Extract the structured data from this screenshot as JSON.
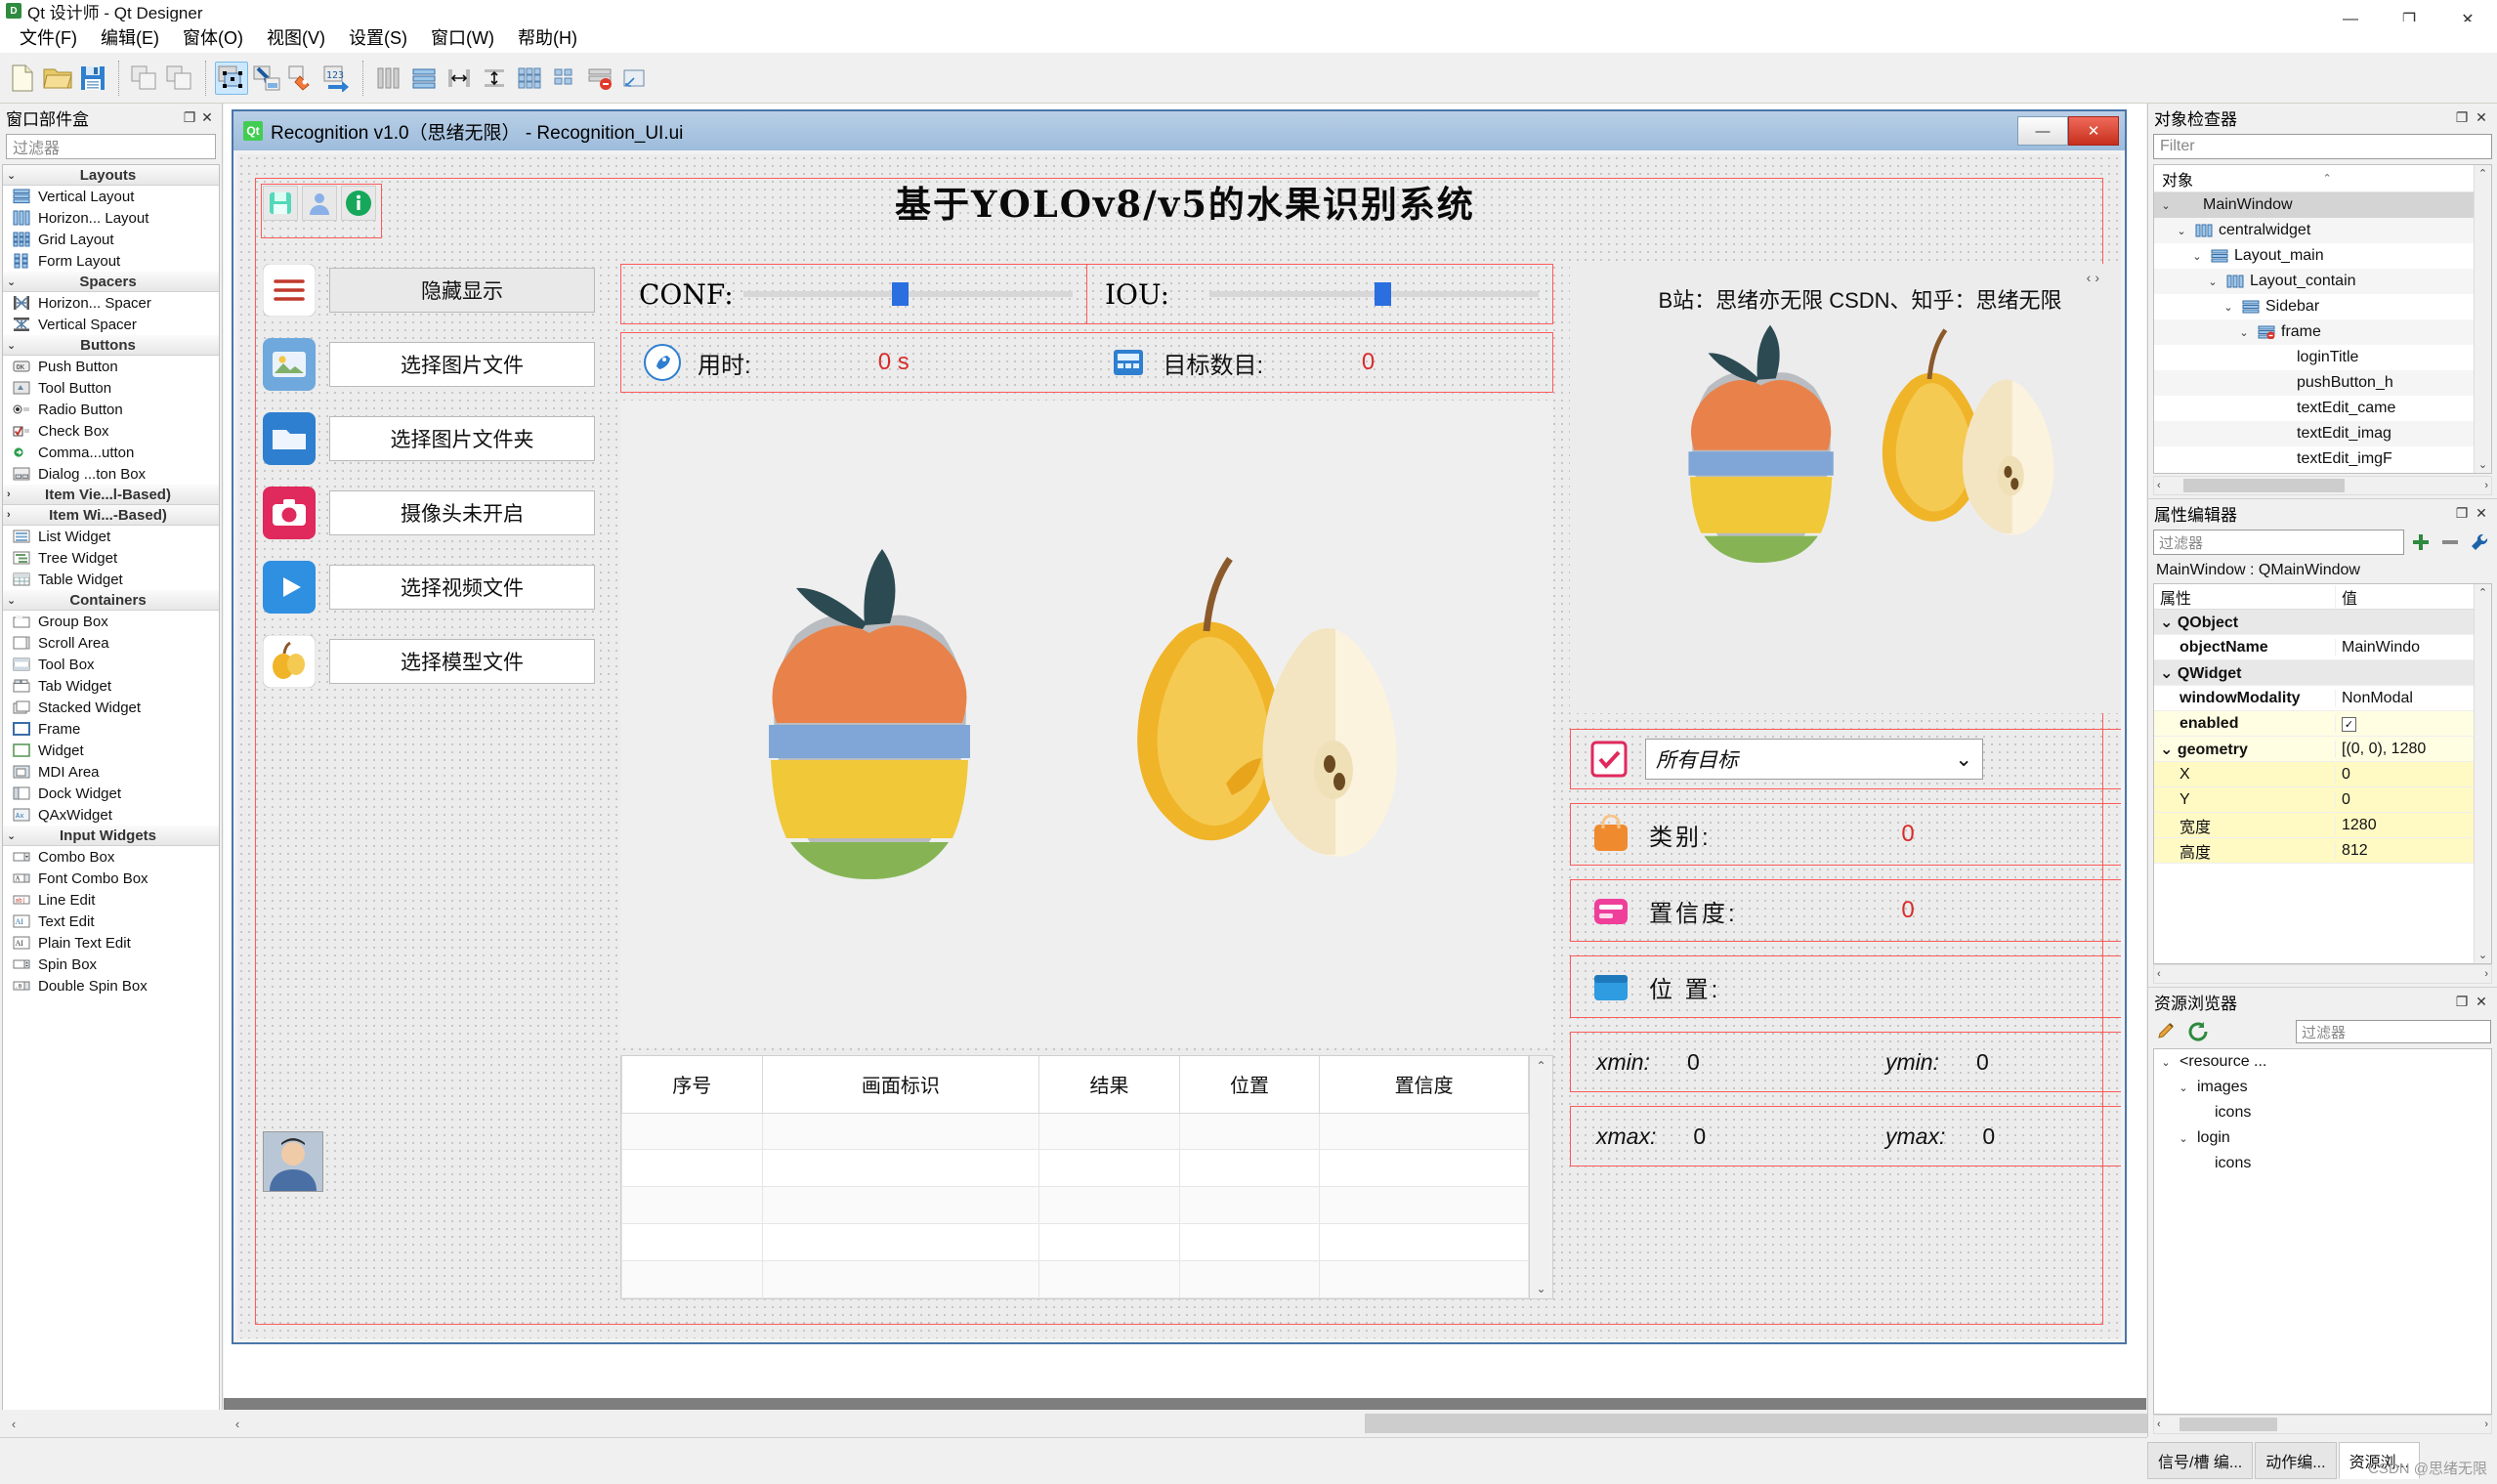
{
  "app": {
    "window_title": "Qt 设计师 - Qt Designer",
    "logo_text": "D",
    "minimize": "—",
    "maximize": "❐",
    "close": "✕"
  },
  "menubar": {
    "items": [
      {
        "label": "文件(F)"
      },
      {
        "label": "编辑(E)"
      },
      {
        "label": "窗体(O)"
      },
      {
        "label": "视图(V)"
      },
      {
        "label": "设置(S)"
      },
      {
        "label": "窗口(W)"
      },
      {
        "label": "帮助(H)"
      }
    ]
  },
  "toolbar": {
    "buttons": [
      {
        "name": "new-form",
        "title": "新建"
      },
      {
        "name": "open-form",
        "title": "打开"
      },
      {
        "name": "save-form",
        "title": "保存"
      },
      {
        "name": "copy",
        "title": "复制"
      },
      {
        "name": "paste",
        "title": "粘贴"
      },
      {
        "name": "edit-widgets",
        "title": "编辑控件",
        "active": true
      },
      {
        "name": "edit-signals-slots",
        "title": "编辑信号/槽"
      },
      {
        "name": "edit-buddies",
        "title": "编辑伙伴"
      },
      {
        "name": "edit-tab-order",
        "title": "编辑 Tab 顺序"
      },
      {
        "name": "layout-horizontal",
        "title": "水平布局"
      },
      {
        "name": "layout-vertical",
        "title": "垂直布局"
      },
      {
        "name": "layout-splitter-h",
        "title": "水平分裂器布局"
      },
      {
        "name": "layout-splitter-v",
        "title": "垂直分裂器布局"
      },
      {
        "name": "layout-grid",
        "title": "栅格布局"
      },
      {
        "name": "layout-form",
        "title": "表单布局"
      },
      {
        "name": "break-layout",
        "title": "打破布局"
      },
      {
        "name": "adjust-size",
        "title": "调整大小"
      }
    ]
  },
  "widget_box": {
    "title": "窗口部件盒",
    "filter_placeholder": "过滤器",
    "groups": [
      {
        "name": "Layouts",
        "items": [
          {
            "label": "Vertical Layout",
            "icon": "vertical-layout-icon"
          },
          {
            "label": "Horizon... Layout",
            "icon": "horizontal-layout-icon"
          },
          {
            "label": "Grid Layout",
            "icon": "grid-layout-icon"
          },
          {
            "label": "Form Layout",
            "icon": "form-layout-icon"
          }
        ]
      },
      {
        "name": "Spacers",
        "items": [
          {
            "label": "Horizon... Spacer",
            "icon": "horizontal-spacer-icon"
          },
          {
            "label": "Vertical Spacer",
            "icon": "vertical-spacer-icon"
          }
        ]
      },
      {
        "name": "Buttons",
        "items": [
          {
            "label": "Push Button",
            "icon": "push-button-icon"
          },
          {
            "label": "Tool Button",
            "icon": "tool-button-icon"
          },
          {
            "label": "Radio Button",
            "icon": "radio-button-icon"
          },
          {
            "label": "Check Box",
            "icon": "check-box-icon"
          },
          {
            "label": "Comma...utton",
            "icon": "command-button-icon"
          },
          {
            "label": "Dialog ...ton Box",
            "icon": "dialog-button-box-icon"
          }
        ]
      },
      {
        "name": "Item Vie...l-Based)",
        "items": []
      },
      {
        "name": "Item Wi...-Based)",
        "items": [
          {
            "label": "List Widget",
            "icon": "list-widget-icon"
          },
          {
            "label": "Tree Widget",
            "icon": "tree-widget-icon"
          },
          {
            "label": "Table Widget",
            "icon": "table-widget-icon"
          }
        ]
      },
      {
        "name": "Containers",
        "items": [
          {
            "label": "Group Box",
            "icon": "group-box-icon"
          },
          {
            "label": "Scroll Area",
            "icon": "scroll-area-icon"
          },
          {
            "label": "Tool Box",
            "icon": "tool-box-icon"
          },
          {
            "label": "Tab Widget",
            "icon": "tab-widget-icon"
          },
          {
            "label": "Stacked Widget",
            "icon": "stacked-widget-icon"
          },
          {
            "label": "Frame",
            "icon": "frame-icon"
          },
          {
            "label": "Widget",
            "icon": "widget-icon"
          },
          {
            "label": "MDI Area",
            "icon": "mdi-area-icon"
          },
          {
            "label": "Dock Widget",
            "icon": "dock-widget-icon"
          },
          {
            "label": "QAxWidget",
            "icon": "qaxwidget-icon"
          }
        ]
      },
      {
        "name": "Input Widgets",
        "items": [
          {
            "label": "Combo Box",
            "icon": "combo-box-icon"
          },
          {
            "label": "Font Combo Box",
            "icon": "font-combo-box-icon"
          },
          {
            "label": "Line Edit",
            "icon": "line-edit-icon"
          },
          {
            "label": "Text Edit",
            "icon": "text-edit-icon"
          },
          {
            "label": "Plain Text Edit",
            "icon": "plain-text-edit-icon"
          },
          {
            "label": "Spin Box",
            "icon": "spin-box-icon"
          },
          {
            "label": "Double Spin Box",
            "icon": "double-spin-box-icon"
          }
        ]
      }
    ]
  },
  "form_window": {
    "title": "Recognition v1.0（思绪无限） - Recognition_UI.ui",
    "qt_badge": "Qt",
    "minimize": "—",
    "close": "✕"
  },
  "form": {
    "app_title": "基于YOLOv8/v5的水果识别系统",
    "top_icons": [
      {
        "name": "save-icon"
      },
      {
        "name": "user-icon"
      },
      {
        "name": "info-icon"
      }
    ],
    "sidebar": [
      {
        "icon": "menu-lines-icon",
        "label": "隐藏显示",
        "kind": "button"
      },
      {
        "icon": "image-icon",
        "label": "选择图片文件",
        "kind": "field"
      },
      {
        "icon": "folder-icon",
        "label": "选择图片文件夹",
        "kind": "field"
      },
      {
        "icon": "camera-icon",
        "label": "摄像头未开启",
        "kind": "field"
      },
      {
        "icon": "video-icon",
        "label": "选择视频文件",
        "kind": "field"
      },
      {
        "icon": "model-icon",
        "label": "选择模型文件",
        "kind": "field"
      }
    ],
    "conf": {
      "label": "CONF:",
      "value": 0.45
    },
    "iou": {
      "label": "IOU:",
      "value": 0.5
    },
    "time": {
      "icon": "rocket-icon",
      "label": "用时:",
      "value": "0 s"
    },
    "count": {
      "icon": "counter-icon",
      "label": "目标数目:",
      "value": "0"
    },
    "table": {
      "columns": [
        "序号",
        "画面标识",
        "结果",
        "位置",
        "置信度"
      ],
      "rows": []
    },
    "right_panel": {
      "banner_text": "B站：思绪亦无限 CSDN、知乎：思绪无限",
      "target_select": {
        "icon": "target-check-icon",
        "value": "所有目标",
        "caret": "⌄"
      },
      "results": [
        {
          "icon": "category-icon",
          "label": "类别:",
          "value": "0"
        },
        {
          "icon": "confidence-icon",
          "label": "置信度:",
          "value": "0"
        },
        {
          "icon": "location-icon",
          "label": "位 置:",
          "value": ""
        }
      ],
      "coords": [
        {
          "label": "xmin:",
          "value": "0",
          "label2": "ymin:",
          "value2": "0"
        },
        {
          "label": "xmax:",
          "value": "0",
          "label2": "ymax:",
          "value2": "0"
        }
      ]
    }
  },
  "object_inspector": {
    "title": "对象检查器",
    "filter_placeholder": "Filter",
    "column_header": "对象",
    "nodes": [
      {
        "label": "MainWindow",
        "depth": 0,
        "twisty": "⌄",
        "icon": "",
        "selected": true
      },
      {
        "label": "centralwidget",
        "depth": 1,
        "twisty": "⌄",
        "icon": "horizontal-layout-icon"
      },
      {
        "label": "Layout_main",
        "depth": 2,
        "twisty": "⌄",
        "icon": "vertical-layout-icon"
      },
      {
        "label": "Layout_contain",
        "depth": 3,
        "twisty": "⌄",
        "icon": "horizontal-layout-icon"
      },
      {
        "label": "Sidebar",
        "depth": 4,
        "twisty": "⌄",
        "icon": "vertical-layout-icon"
      },
      {
        "label": "frame",
        "depth": 5,
        "twisty": "⌄",
        "icon": "broken-layout-icon"
      },
      {
        "label": "loginTitle",
        "depth": 6,
        "twisty": "",
        "icon": ""
      },
      {
        "label": "pushButton_h",
        "depth": 6,
        "twisty": "",
        "icon": ""
      },
      {
        "label": "textEdit_came",
        "depth": 6,
        "twisty": "",
        "icon": ""
      },
      {
        "label": "textEdit_imag",
        "depth": 6,
        "twisty": "",
        "icon": ""
      },
      {
        "label": "textEdit_imgF",
        "depth": 6,
        "twisty": "",
        "icon": ""
      }
    ]
  },
  "property_editor": {
    "title": "属性编辑器",
    "filter_placeholder": "过滤器",
    "add_icon": "plus-icon",
    "remove_icon": "minus-icon",
    "config_icon": "wrench-icon",
    "object_line": "MainWindow : QMainWindow",
    "col_key": "属性",
    "col_value": "值",
    "rows": [
      {
        "key": "QObject",
        "value": "",
        "group": true
      },
      {
        "key": "objectName",
        "value": "MainWindo",
        "bold": true,
        "indent": true
      },
      {
        "key": "QWidget",
        "value": "",
        "group": true
      },
      {
        "key": "windowModality",
        "value": "NonModal",
        "bold": true,
        "indent": true
      },
      {
        "key": "enabled",
        "value": "",
        "bold": true,
        "indent": true,
        "checkbox": true,
        "checked": true,
        "highlight": true
      },
      {
        "key": "geometry",
        "value": "[(0, 0), 1280",
        "bold": true,
        "twisty": "⌄",
        "highlight": true
      },
      {
        "key": "X",
        "value": "0",
        "indent": true,
        "highlight2": true
      },
      {
        "key": "Y",
        "value": "0",
        "indent": true,
        "highlight2": true
      },
      {
        "key": "宽度",
        "value": "1280",
        "indent": true,
        "highlight2": true
      },
      {
        "key": "高度",
        "value": "812",
        "indent": true,
        "highlight2": true
      }
    ]
  },
  "resource_browser": {
    "title": "资源浏览器",
    "edit_icon": "pencil-icon",
    "reload_icon": "reload-icon",
    "filter_placeholder": "过滤器",
    "nodes": [
      {
        "label": "<resource ...",
        "depth": 0,
        "twisty": "⌄"
      },
      {
        "label": "images",
        "depth": 1,
        "twisty": "⌄"
      },
      {
        "label": "icons",
        "depth": 2,
        "twisty": ""
      },
      {
        "label": "login",
        "depth": 1,
        "twisty": "⌄"
      },
      {
        "label": "icons",
        "depth": 2,
        "twisty": ""
      }
    ]
  },
  "bottom_tabs": [
    {
      "label": "信号/槽 编...",
      "selected": false
    },
    {
      "label": "动作编...",
      "selected": false
    },
    {
      "label": "资源浏...",
      "selected": true
    }
  ],
  "watermark": "CSDN @思绪无限",
  "scroll": {
    "left_arrow": "‹",
    "right_arrow": "›",
    "up_arrow": "⌃",
    "down_arrow": "⌄"
  },
  "colors": {
    "accent": "#2a6ee0",
    "red": "#d92b2b",
    "title_bar": "#9dbcdc",
    "designer_green": "#41cd52"
  }
}
